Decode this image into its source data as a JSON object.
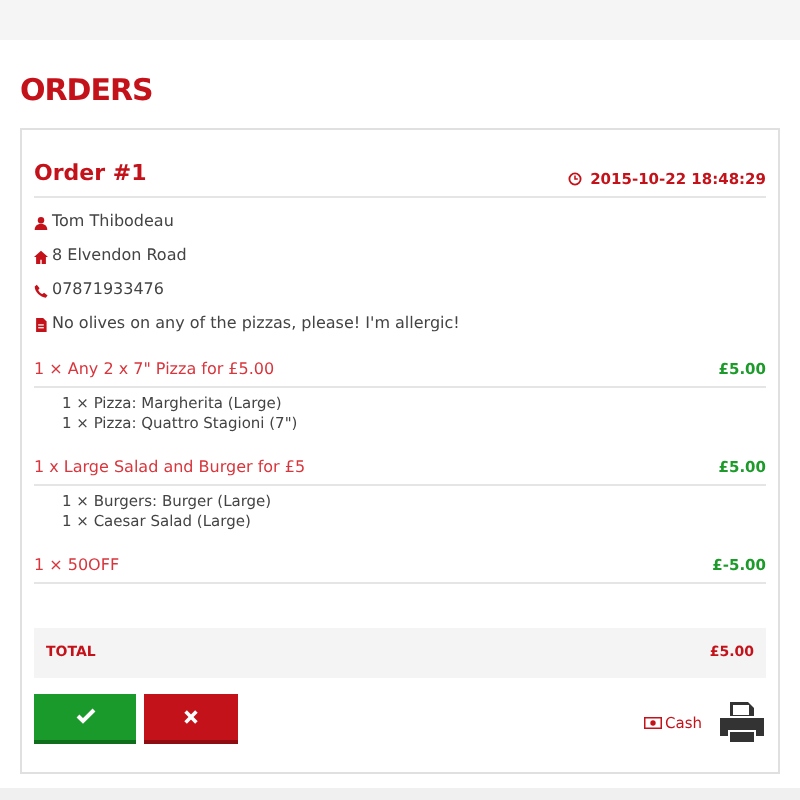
{
  "page_title": "ORDERS",
  "order": {
    "title": "Order #1",
    "time": "2015-10-22 18:48:29",
    "customer": "Tom Thibodeau",
    "address": "8 Elvendon Road",
    "phone": "07871933476",
    "note": "No olives on any of the pizzas, please! I'm allergic!",
    "items": [
      {
        "name": "1 × Any 2 x 7\" Pizza for £5.00",
        "price": "£5.00",
        "children": [
          {
            "name": "1 × Pizza: Margherita (Large)"
          },
          {
            "name": "1 × Pizza: Quattro Stagioni (7\")"
          }
        ]
      },
      {
        "name": "1 x Large Salad and Burger for £5",
        "price": "£5.00",
        "children": [
          {
            "name": "1 × Burgers: Burger (Large)"
          },
          {
            "name": "1 × Caesar Salad (Large)"
          }
        ]
      },
      {
        "name": "1 × 50OFF",
        "price": "£-5.00"
      }
    ],
    "total_label": "TOTAL",
    "total": "£5.00",
    "payment": "Cash"
  }
}
